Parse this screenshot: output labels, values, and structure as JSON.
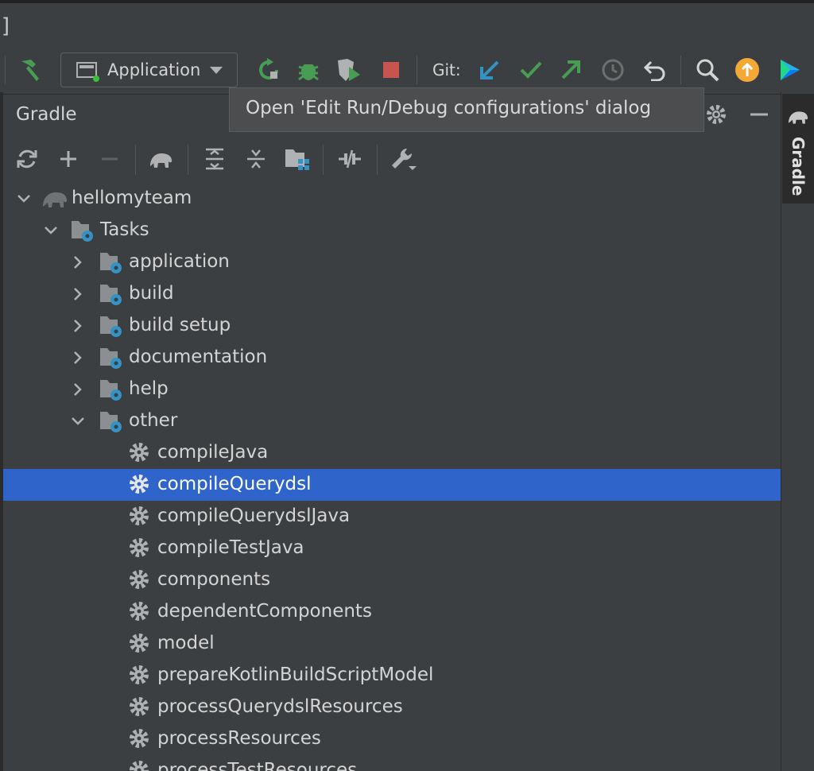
{
  "window": {
    "bracket": "]"
  },
  "toolbar": {
    "run_config_label": "Application",
    "git_label": "Git:"
  },
  "tooltip": {
    "text": "Open 'Edit Run/Debug configurations' dialog"
  },
  "panel": {
    "title": "Gradle"
  },
  "side_tab": {
    "label": "Gradle"
  },
  "tree": {
    "project": "hellomyteam",
    "tasks": "Tasks",
    "groups": [
      "application",
      "build",
      "build setup",
      "documentation",
      "help",
      "other"
    ],
    "other_tasks": [
      "compileJava",
      "compileQuerydsl",
      "compileQuerydslJava",
      "compileTestJava",
      "components",
      "dependentComponents",
      "model",
      "prepareKotlinBuildScriptModel",
      "processQuerydslResources",
      "processResources",
      "processTestResources"
    ],
    "selected": "compileQuerydsl"
  },
  "colors": {
    "background": "#3c3f41",
    "selection": "#2f65ca",
    "run_green": "#499c54",
    "stop_red": "#c75450",
    "git_blue": "#3592c4",
    "update_orange": "#f4a836"
  }
}
